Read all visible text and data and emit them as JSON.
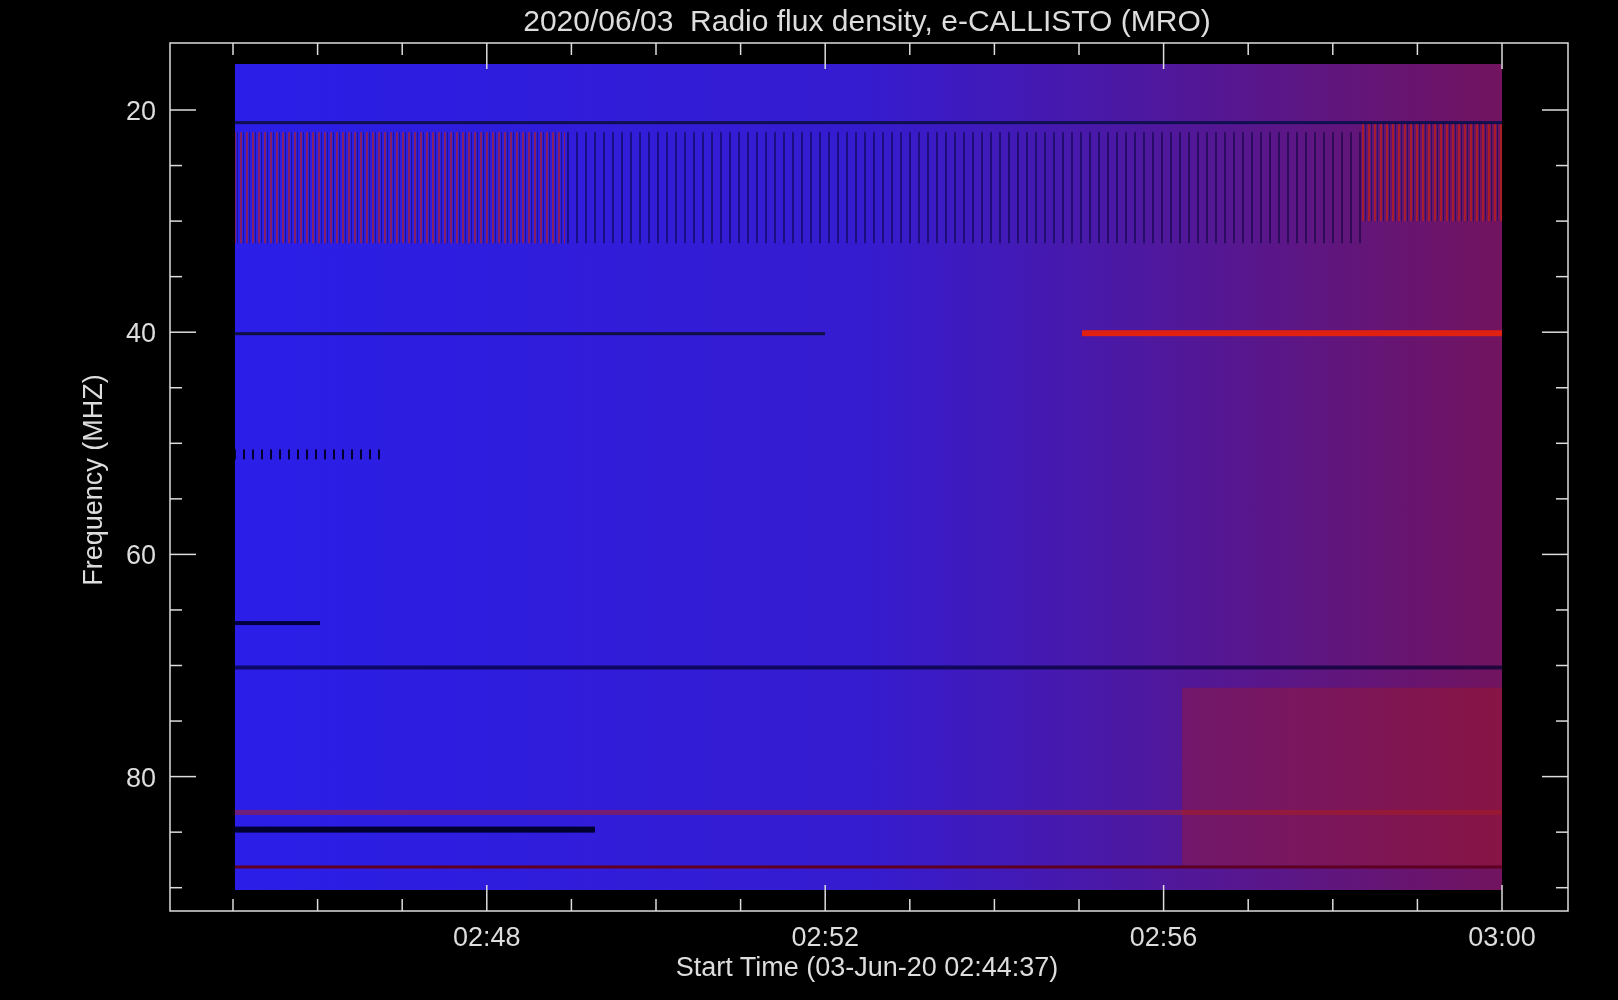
{
  "title": "2020/06/03  Radio flux density, e-CALLISTO (MRO)",
  "y_axis": {
    "label": "Frequency (MHZ)",
    "ticks": [
      "20",
      "40",
      "60",
      "80"
    ]
  },
  "x_axis": {
    "label": "Start Time (03-Jun-20 02:44:37)",
    "ticks": [
      "02:48",
      "02:52",
      "02:56",
      "03:00"
    ]
  }
}
